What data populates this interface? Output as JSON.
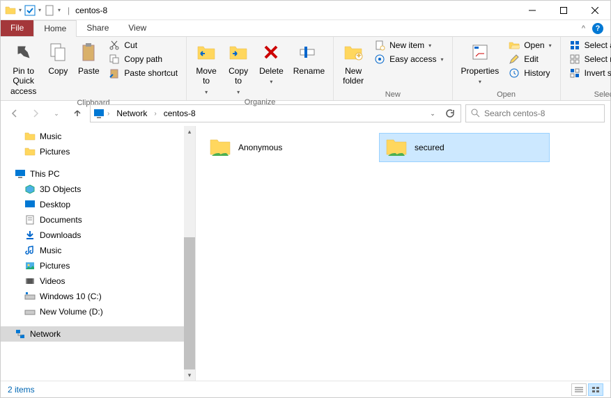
{
  "window": {
    "title": "centos-8"
  },
  "tabs": {
    "file": "File",
    "home": "Home",
    "share": "Share",
    "view": "View"
  },
  "ribbon": {
    "clipboard": {
      "label": "Clipboard",
      "pin": "Pin to Quick\naccess",
      "copy": "Copy",
      "paste": "Paste",
      "cut": "Cut",
      "copy_path": "Copy path",
      "paste_shortcut": "Paste shortcut"
    },
    "organize": {
      "label": "Organize",
      "move_to": "Move\nto",
      "copy_to": "Copy\nto",
      "delete": "Delete",
      "rename": "Rename"
    },
    "new": {
      "label": "New",
      "new_folder": "New\nfolder",
      "new_item": "New item",
      "easy_access": "Easy access"
    },
    "open": {
      "label": "Open",
      "properties": "Properties",
      "open": "Open",
      "edit": "Edit",
      "history": "History"
    },
    "select": {
      "label": "Select",
      "select_all": "Select all",
      "select_none": "Select none",
      "invert": "Invert selection"
    }
  },
  "address": {
    "crumbs": [
      "Network",
      "centos-8"
    ]
  },
  "search": {
    "placeholder": "Search centos-8"
  },
  "tree": {
    "music": "Music",
    "pictures": "Pictures",
    "this_pc": "This PC",
    "objects3d": "3D Objects",
    "desktop": "Desktop",
    "documents": "Documents",
    "downloads": "Downloads",
    "music2": "Music",
    "pictures2": "Pictures",
    "videos": "Videos",
    "c_drive": "Windows 10 (C:)",
    "d_drive": "New Volume (D:)",
    "network": "Network"
  },
  "items": [
    {
      "name": "Anonymous",
      "selected": false
    },
    {
      "name": "secured",
      "selected": true
    }
  ],
  "status": {
    "text": "2 items"
  }
}
